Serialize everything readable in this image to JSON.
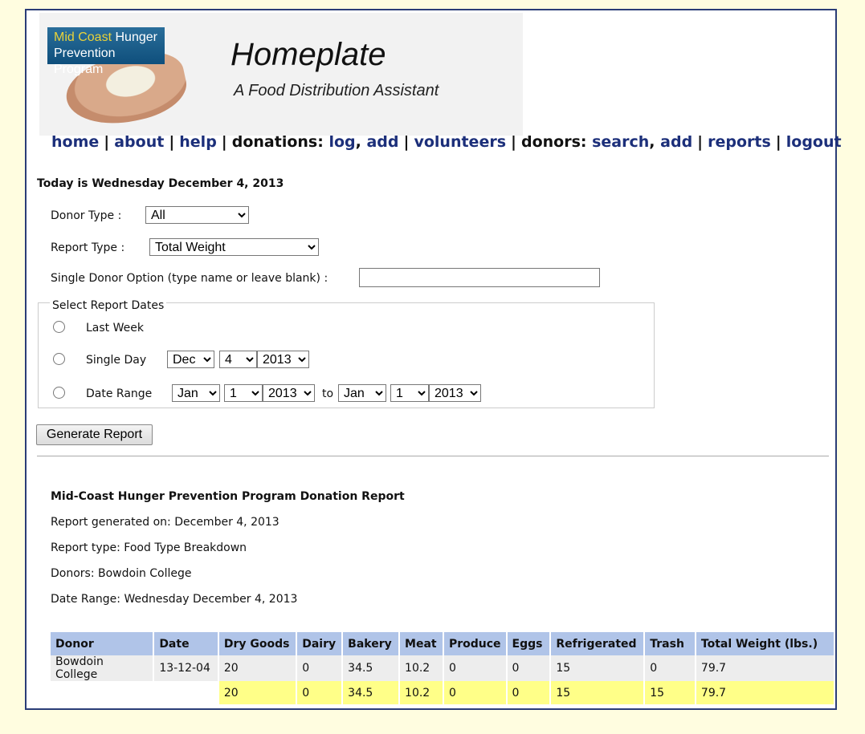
{
  "header": {
    "logo_line1_a": "Mid Coast",
    "logo_line1_b": "Hunger",
    "logo_line2": "Prevention Program",
    "title": "Homeplate",
    "subtitle": "A Food Distribution Assistant"
  },
  "nav": {
    "home": "home",
    "about": "about",
    "help": "help",
    "donations_label": "donations:",
    "log": "log",
    "add": "add",
    "volunteers": "volunteers",
    "donors_label": "donors:",
    "search": "search",
    "donors_add": "add",
    "reports": "reports",
    "logout": "logout",
    "separator": "|"
  },
  "today": "Today is Wednesday December 4, 2013",
  "form": {
    "donor_type_label": "Donor Type :",
    "donor_type_value": "All",
    "report_type_label": "Report Type :",
    "report_type_value": "Total Weight",
    "single_donor_label": "Single Donor Option (type name or leave blank) :",
    "single_donor_value": "",
    "dates_legend": "Select Report Dates",
    "last_week_label": "Last Week",
    "single_day_label": "Single Day",
    "single_day": {
      "month": "Dec",
      "day": "4",
      "year": "2013"
    },
    "date_range_label": "Date Range",
    "range_from": {
      "month": "Jan",
      "day": "1",
      "year": "2013"
    },
    "range_to_label": "to",
    "range_to": {
      "month": "Jan",
      "day": "1",
      "year": "2013"
    },
    "generate_button": "Generate Report"
  },
  "report": {
    "title": "Mid-Coast Hunger Prevention Program Donation Report",
    "generated": "Report generated on: December 4, 2013",
    "type": "Report type: Food Type Breakdown",
    "donors": "Donors: Bowdoin College",
    "date_range": "Date Range: Wednesday December 4, 2013",
    "columns": [
      "Donor",
      "Date",
      "Dry Goods",
      "Dairy",
      "Bakery",
      "Meat",
      "Produce",
      "Eggs",
      "Refrigerated",
      "Trash",
      "Total Weight (lbs.)"
    ],
    "rows": [
      [
        "Bowdoin College",
        "13-12-04",
        "20",
        "0",
        "34.5",
        "10.2",
        "0",
        "0",
        "15",
        "0",
        "79.7"
      ]
    ],
    "totals": [
      "",
      "",
      "20",
      "0",
      "34.5",
      "10.2",
      "0",
      "0",
      "15",
      "15",
      "79.7"
    ]
  }
}
